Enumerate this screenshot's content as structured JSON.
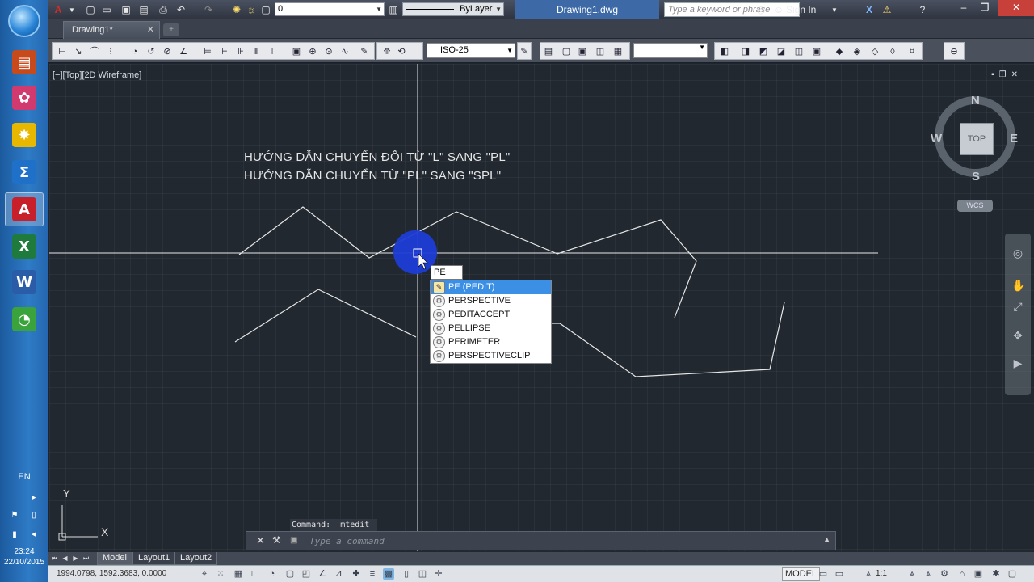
{
  "taskbar": {
    "apps": [
      {
        "name": "clipboard",
        "glyph": "▤",
        "color": "#c74a1c"
      },
      {
        "name": "brain-app",
        "glyph": "✿",
        "color": "#d13a6e"
      },
      {
        "name": "star-app",
        "glyph": "✸",
        "color": "#e8b800"
      },
      {
        "name": "sigma-app",
        "glyph": "Σ",
        "color": "#1f70c8"
      },
      {
        "name": "autocad",
        "glyph": "A",
        "color": "#c8202a"
      },
      {
        "name": "excel",
        "glyph": "X",
        "color": "#1f7a3e"
      },
      {
        "name": "word",
        "glyph": "W",
        "color": "#2b5ca8"
      },
      {
        "name": "green-app",
        "glyph": "◔",
        "color": "#3aa33c"
      }
    ],
    "lang": "EN",
    "time": "23:24",
    "date": "22/10/2015"
  },
  "titlebar": {
    "layer_value": "0",
    "linetype": "ByLayer",
    "doc_title": "Drawing1.dwg",
    "search_placeholder": "Type a keyword or phrase",
    "sign_in": "Sign In"
  },
  "filetab": {
    "label": "Drawing1*"
  },
  "toolbar": {
    "dimstyle": "ISO-25"
  },
  "viewport": {
    "label": "[−][Top][2D Wireframe]"
  },
  "drawing_text": [
    "HƯỚNG DẪN CHUYỂN ĐỔI TỪ \"L\" SANG \"PL\"",
    "HƯỚNG DẪN CHUYỂN TỪ \"PL\" SANG \"SPL\""
  ],
  "viewcube": {
    "face": "TOP",
    "north": "N",
    "south": "S",
    "east": "E",
    "west": "W",
    "wcs": "WCS"
  },
  "command_tooltip": {
    "typed": "PE",
    "suggestions": [
      {
        "label": "PE (PEDIT)",
        "selected": true
      },
      {
        "label": "PERSPECTIVE",
        "selected": false
      },
      {
        "label": "PEDITACCEPT",
        "selected": false
      },
      {
        "label": "PELLIPSE",
        "selected": false
      },
      {
        "label": "PERIMETER",
        "selected": false
      },
      {
        "label": "PERSPECTIVECLIP",
        "selected": false
      }
    ]
  },
  "ucs": {
    "x": "X",
    "y": "Y"
  },
  "command_line": {
    "history": "Command: _mtedit",
    "placeholder": "Type a command"
  },
  "layout_tabs": [
    "Model",
    "Layout1",
    "Layout2"
  ],
  "statusbar": {
    "coords": "1994.0798, 1592.3683, 0.0000",
    "model": "MODEL",
    "scale": "1:1"
  }
}
